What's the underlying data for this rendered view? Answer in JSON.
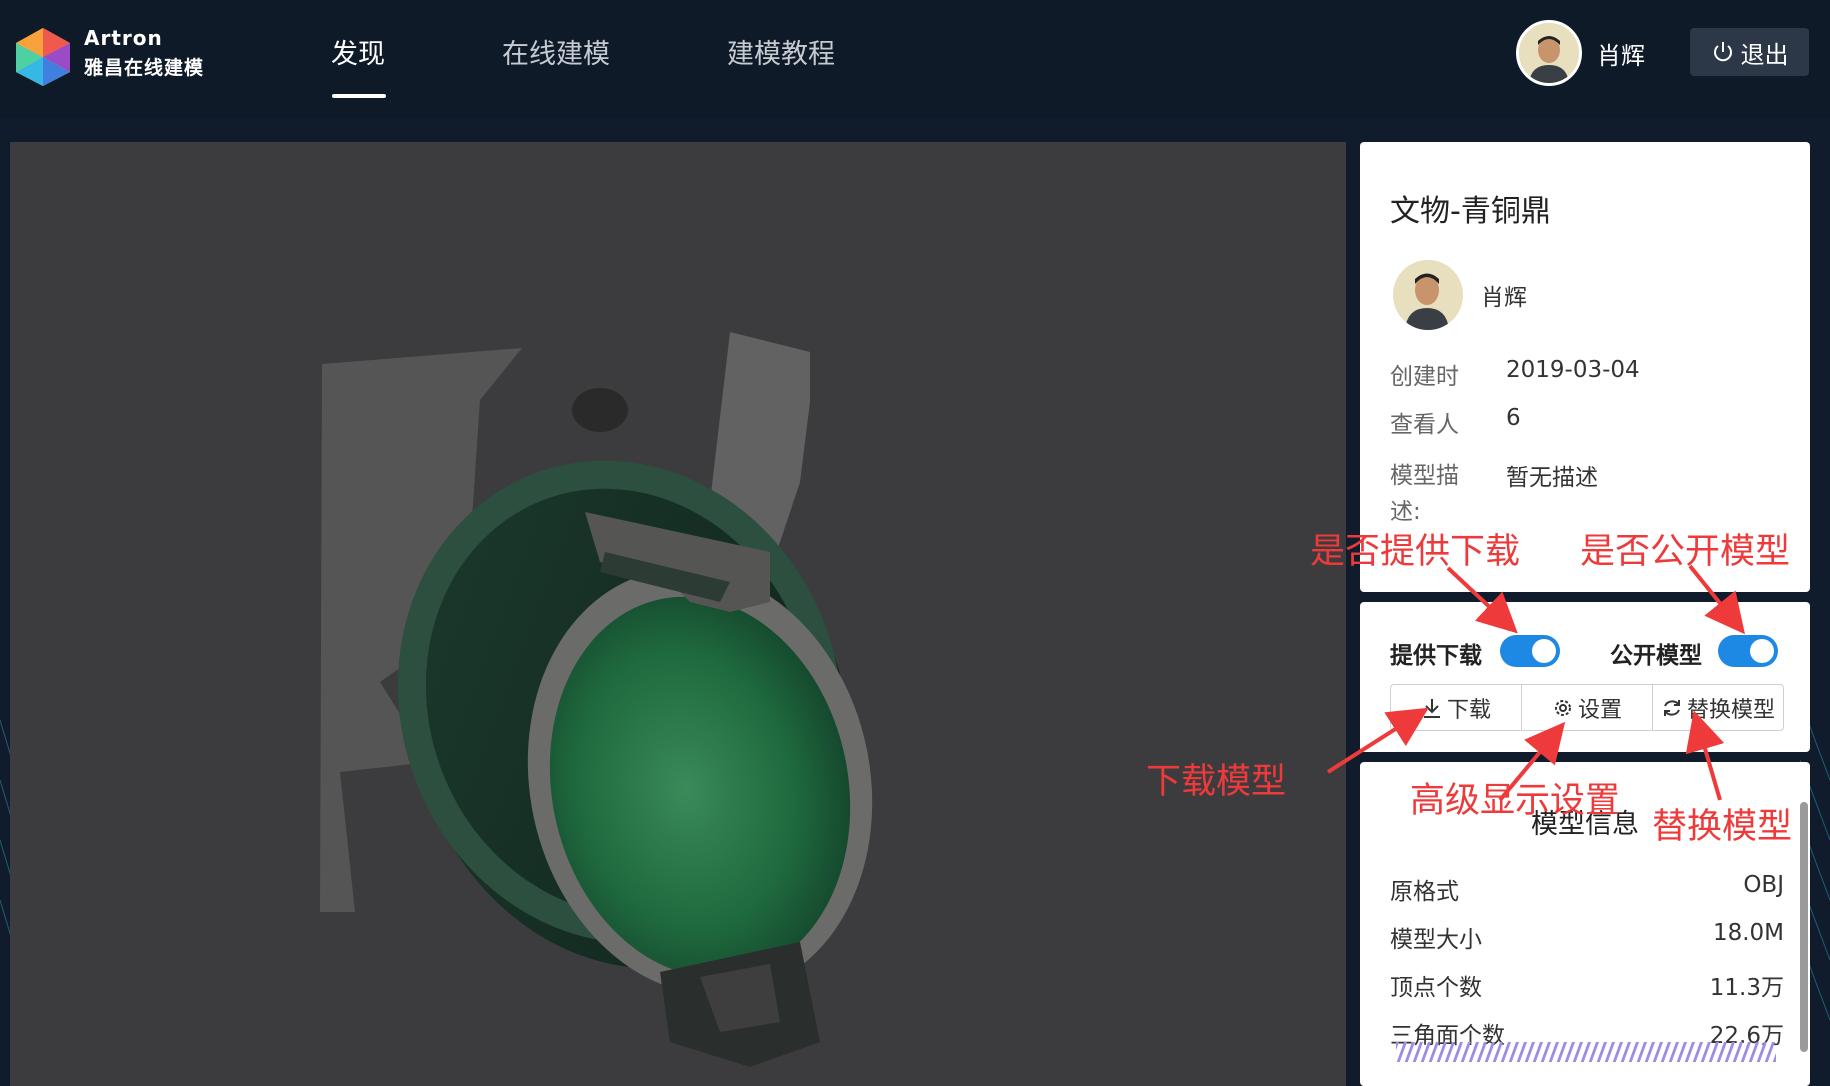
{
  "header": {
    "brand_en": "Artron",
    "brand_cn": "雅昌在线建模",
    "nav": [
      {
        "label": "发现",
        "active": true
      },
      {
        "label": "在线建模",
        "active": false
      },
      {
        "label": "建模教程",
        "active": false
      }
    ],
    "user_name": "肖辉",
    "logout_label": "退出"
  },
  "model": {
    "title": "文物-青铜鼎",
    "author": "肖辉",
    "meta": [
      {
        "label": "创建时",
        "value": "2019-03-04"
      },
      {
        "label": "查看人",
        "value": "6"
      },
      {
        "label": "模型描\n述:",
        "value": "暂无描述"
      }
    ]
  },
  "actions": {
    "download_switch_label": "提供下载",
    "download_switch_on": true,
    "public_switch_label": "公开模型",
    "public_switch_on": true,
    "download_btn": "下载",
    "settings_btn": "设置",
    "replace_btn": "替换模型"
  },
  "specs": {
    "title": "模型信息",
    "rows": [
      {
        "label": "原格式",
        "value": "OBJ"
      },
      {
        "label": "模型大小",
        "value": "18.0M"
      },
      {
        "label": "顶点个数",
        "value": "11.3万"
      },
      {
        "label": "三角面个数",
        "value": "22.6万"
      }
    ]
  },
  "annotations": {
    "provide_download": "是否提供下载",
    "public_model": "是否公开模型",
    "download_model": "下载模型",
    "advanced_display": "高级显示设置",
    "replace_model": "替换模型"
  },
  "colors": {
    "header_bg": "#0f1a29",
    "viewer_bg": "#3c3c3e",
    "switch_on": "#1e88e5",
    "annotation": "#ee3a3a"
  }
}
